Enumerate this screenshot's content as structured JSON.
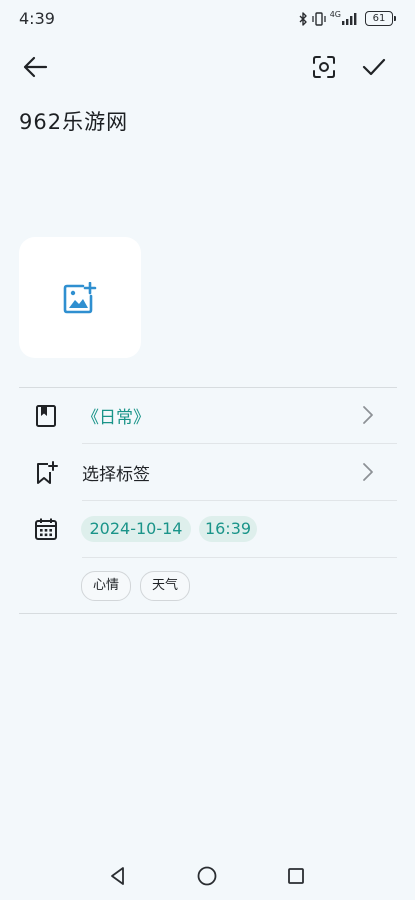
{
  "status_bar": {
    "time": "4:39",
    "network_label": "4G",
    "battery_level": "61",
    "icons": [
      "bluetooth-icon",
      "vibrate-icon",
      "signal-icon",
      "battery-icon"
    ]
  },
  "toolbar": {
    "back_icon": "arrow-left-icon",
    "scan_icon": "scan-icon",
    "confirm_icon": "check-icon"
  },
  "entry": {
    "title": "962乐游网",
    "add_image_icon": "add-image-icon"
  },
  "details": {
    "notebook": {
      "icon": "notebook-icon",
      "label": "《日常》"
    },
    "tags": {
      "icon": "bookmark-add-icon",
      "label": "选择标签"
    },
    "datetime": {
      "icon": "calendar-icon",
      "date": "2024-10-14",
      "time": "16:39"
    },
    "chips": [
      {
        "label": "心情"
      },
      {
        "label": "天气"
      }
    ]
  },
  "colors": {
    "background": "#f3f8fb",
    "accent": "#1a9489",
    "accent_light": "#deefec",
    "image_icon": "#2f8fd0"
  },
  "nav_bar": {
    "back_icon": "triangle-back-icon",
    "home_icon": "circle-home-icon",
    "recent_icon": "square-recent-icon"
  }
}
